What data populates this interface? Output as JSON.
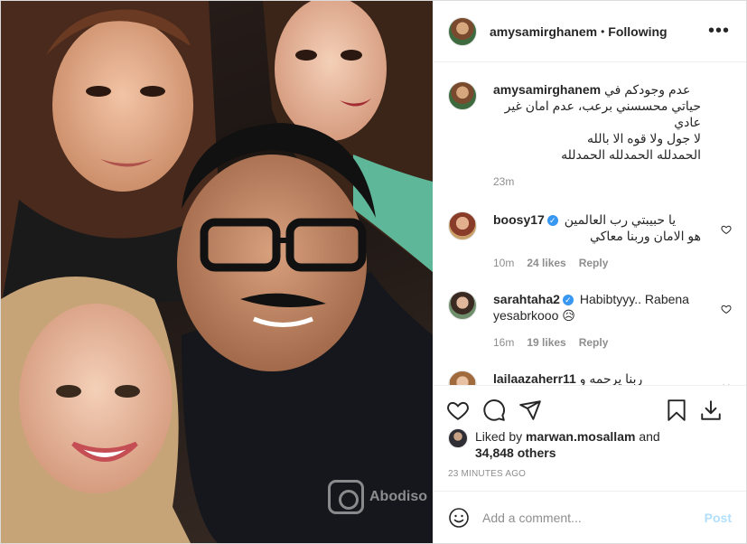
{
  "header": {
    "username": "amysamirghanem",
    "dot": "•",
    "follow_status": "Following",
    "more_label": "•••"
  },
  "caption": {
    "username": "amysamirghanem",
    "line1": "عدم وجودكم في",
    "line2": "حياتي محسسني برعب، عدم امان غير",
    "line3": "عادي",
    "line4": "لا جول ولا قوه الا بالله",
    "line5": "الحمدلله الحمدلله الحمدلله",
    "time": "23m"
  },
  "comments": [
    {
      "username": "boosy17",
      "text_line1": "يا حبيبتي رب العالمين",
      "text_line2": "هو الامان وربنا معاكي",
      "time": "10m",
      "likes": "24 likes",
      "reply": "Reply"
    },
    {
      "username": "sarahtaha2",
      "text": "Habibtyyy.. Rabena yesabrkooo 😥",
      "time": "16m",
      "likes": "19 likes",
      "reply": "Reply"
    },
    {
      "username": "lailaazaherr11",
      "text": "ربنا يرحمه و"
    }
  ],
  "likes": {
    "prefix": "Liked by",
    "user": "marwan.mosallam",
    "and": "and",
    "others": "34,848 others"
  },
  "posted": "23 MINUTES AGO",
  "add_comment": {
    "placeholder": "Add a comment...",
    "post_label": "Post"
  },
  "watermark": "Abodiso",
  "colors": {
    "verified": "#3897f0",
    "muted": "#8e8e8e",
    "post_disabled": "#b2dffc"
  },
  "icons": [
    "heart-icon",
    "comment-icon",
    "share-icon",
    "bookmark-icon",
    "download-icon",
    "emoji-icon",
    "more-icon"
  ]
}
